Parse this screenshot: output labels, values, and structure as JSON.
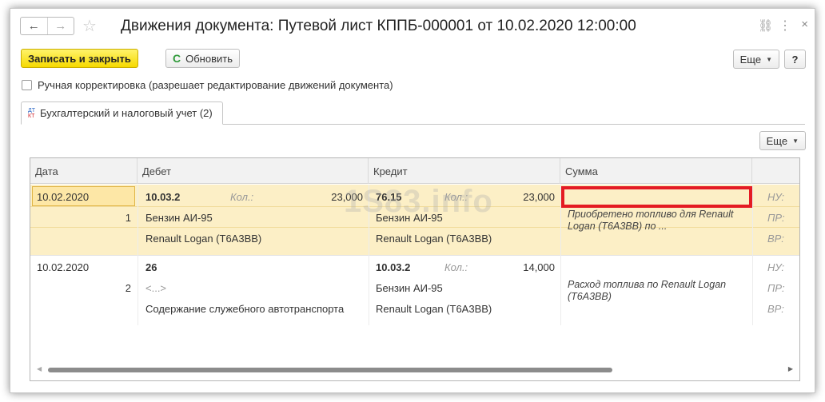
{
  "window": {
    "title": "Движения документа: Путевой лист КППБ-000001 от 10.02.2020 12:00:00",
    "nav_back": "←",
    "nav_forward": "→",
    "star": "☆",
    "link_icon": "⛓",
    "more_icon": "⋮",
    "close_icon": "×"
  },
  "toolbar": {
    "save_close": "Записать и закрыть",
    "refresh": "Обновить",
    "refresh_icon": "C",
    "more": "Еще",
    "help": "?"
  },
  "checkbox": {
    "label": "Ручная корректировка (разрешает редактирование движений документа)",
    "checked": false
  },
  "tab": {
    "dt": "ДТ",
    "kt": "КТ",
    "label": "Бухгалтерский и налоговый учет (2)"
  },
  "grid_toolbar": {
    "more": "Еще"
  },
  "watermark": "1S83.info",
  "grid": {
    "headers": {
      "date": "Дата",
      "debit": "Дебет",
      "credit": "Кредит",
      "sum": "Сумма"
    },
    "rows": [
      {
        "date": "10.02.2020",
        "num": "1",
        "debit_account": "10.03.2",
        "debit_qty_label": "Кол.:",
        "debit_qty": "23,000",
        "debit_sub1": "Бензин АИ-95",
        "debit_sub2": "Renault Logan (Т6А3ВВ)",
        "credit_account": "76.15",
        "credit_qty_label": "Кол.:",
        "credit_qty": "23,000",
        "credit_sub1": "Бензин АИ-95",
        "credit_sub2": "Renault Logan (Т6А3ВВ)",
        "sum": "",
        "content": "Приобретено топливо для Renault Logan (Т6А3ВВ) по ...",
        "nu": "НУ:",
        "pr": "ПР:",
        "vr": "ВР:"
      },
      {
        "date": "10.02.2020",
        "num": "2",
        "debit_account": "26",
        "debit_qty_label": "",
        "debit_qty": "",
        "debit_sub1": "<...>",
        "debit_sub2": "Содержание служебного автотранспорта",
        "credit_account": "10.03.2",
        "credit_qty_label": "Кол.:",
        "credit_qty": "14,000",
        "credit_sub1": "Бензин АИ-95",
        "credit_sub2": "Renault Logan (Т6А3ВВ)",
        "sum": "",
        "content": "Расход топлива по Renault Logan (Т6А3ВВ)",
        "nu": "НУ:",
        "pr": "ПР:",
        "vr": "ВР:"
      }
    ]
  },
  "colors": {
    "primary_button": "#f6d900",
    "selected_row": "#fcefc6",
    "highlight_border": "#e41b23"
  }
}
